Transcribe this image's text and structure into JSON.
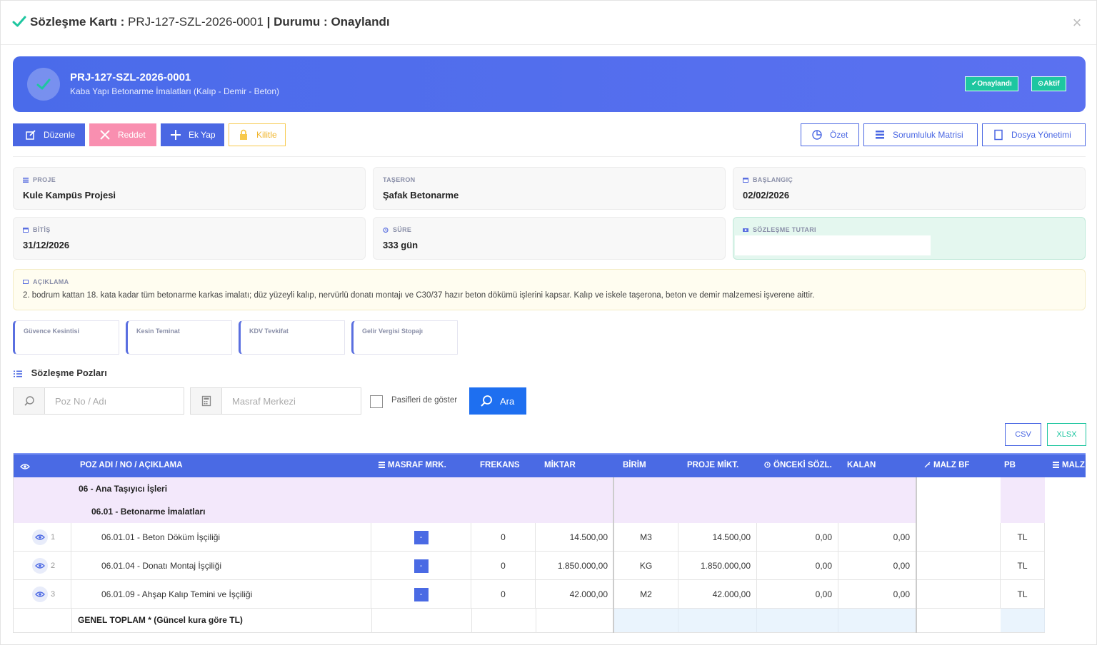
{
  "modal": {
    "title_prefix": "Sözleşme Kartı : ",
    "title_code": "PRJ-127-SZL-2026-0001",
    "title_sep": " | ",
    "title_status_label": "Durumu : ",
    "title_status": "Onaylandı",
    "close_icon": "×"
  },
  "hero": {
    "code": "PRJ-127-SZL-2026-0001",
    "description": "Kaba Yapı Betonarme İmalatları (Kalıp - Demir - Beton)",
    "badge_approved": "✔Onaylandı",
    "badge_active": "⊙Aktif",
    "accent": "#4a6bea",
    "badge_color": "#1ec6a0"
  },
  "actions": {
    "edit": "Düzenle",
    "reject": "Reddet",
    "add": "Ek Yap",
    "lock": "Kilitle",
    "summary": "Özet",
    "matrix": "Sorumluluk Matrisi",
    "files": "Dosya Yönetimi"
  },
  "info": {
    "proje_label": "PROJE",
    "proje_value": "Kule Kampüs Projesi",
    "taseron_label": "TAŞERON",
    "taseron_value": "Şafak Betonarme",
    "baslangic_label": "BAŞLANGIÇ",
    "baslangic_value": "02/02/2026",
    "bitis_label": "BİTİŞ",
    "bitis_value": "31/12/2026",
    "sure_label": "SÜRE",
    "sure_value": "333 gün",
    "tutar_label": "SÖZLEŞME TUTARI",
    "aciklama_label": "AÇIKLAMA",
    "aciklama_text": "2. bodrum kattan 18. kata kadar tüm betonarme karkas imalatı; düz yüzeyli kalıp, nervürlü donatı montajı ve C30/37 hazır beton dökümü işlerini kapsar. Kalıp ve iskele taşerona, beton ve demir malzemesi işverene aittir."
  },
  "deductions": [
    "Güvence Kesintisi",
    "Kesin Teminat",
    "KDV Tevkifat",
    "Gelir Vergisi Stopajı"
  ],
  "positions": {
    "title": "Sözleşme Pozları",
    "search_placeholder": "Poz No / Adı",
    "cost_placeholder": "Masraf Merkezi",
    "show_passive": "Pasifleri de göster",
    "search_button": "Ara",
    "csv": "CSV",
    "xlsx": "XLSX"
  },
  "table": {
    "headers": {
      "poz": "POZ ADI / NO / AÇIKLAMA",
      "masraf": "MASRAF MRK.",
      "frekans": "FREKANS",
      "miktar": "MİKTAR",
      "birim": "BİRİM",
      "proje": "PROJE MİKT.",
      "onceki": "ÖNCEKİ SÖZL.",
      "kalan": "KALAN",
      "malzbf": "MALZ BF",
      "pb": "PB",
      "malz": "MALZ"
    },
    "group1": "06 - Ana Taşıyıcı İşleri",
    "group2": "06.01 - Betonarme İmalatları",
    "rows": [
      {
        "no": "1",
        "name": "06.01.01 - Beton Döküm İşçiliği",
        "masraf": "-",
        "frekans": "0",
        "miktar": "14.500,00",
        "birim": "M3",
        "proje": "14.500,00",
        "onceki": "0,00",
        "kalan": "0,00",
        "pb": "TL"
      },
      {
        "no": "2",
        "name": "06.01.04 - Donatı Montaj İşçiliği",
        "masraf": "-",
        "frekans": "0",
        "miktar": "1.850.000,00",
        "birim": "KG",
        "proje": "1.850.000,00",
        "onceki": "0,00",
        "kalan": "0,00",
        "pb": "TL"
      },
      {
        "no": "3",
        "name": "06.01.09 - Ahşap Kalıp Temini ve İşçiliği",
        "masraf": "-",
        "frekans": "0",
        "miktar": "42.000,00",
        "birim": "M2",
        "proje": "42.000,00",
        "onceki": "0,00",
        "kalan": "0,00",
        "pb": "TL"
      }
    ],
    "total_label": "GENEL TOPLAM * (Güncel kura göre TL)"
  }
}
